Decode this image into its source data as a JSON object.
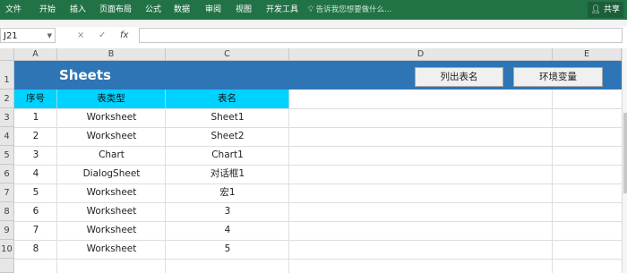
{
  "ribbon": {
    "tabs": [
      "文件",
      "开始",
      "插入",
      "页面布局",
      "公式",
      "数据",
      "审阅",
      "视图",
      "开发工具"
    ],
    "tell_me": "告诉我您想要做什么...",
    "share": "共享"
  },
  "formula_bar": {
    "name_box": "J21",
    "cancel": "×",
    "enter": "✓",
    "fx": "fx",
    "content": ""
  },
  "columns": [
    "A",
    "B",
    "C",
    "D",
    "E"
  ],
  "rows": [
    "1",
    "2",
    "3",
    "4",
    "5",
    "6",
    "7",
    "8",
    "9",
    "10"
  ],
  "sheet": {
    "title": "Sheets",
    "buttons": {
      "list_names": "列出表名",
      "env_vars": "环境变量"
    },
    "headers": [
      "序号",
      "表类型",
      "表名"
    ],
    "data": [
      [
        "1",
        "Worksheet",
        "Sheet1"
      ],
      [
        "2",
        "Worksheet",
        "Sheet2"
      ],
      [
        "3",
        "Chart",
        "Chart1"
      ],
      [
        "4",
        "DialogSheet",
        "对话框1"
      ],
      [
        "5",
        "Worksheet",
        "宏1"
      ],
      [
        "6",
        "Worksheet",
        "3"
      ],
      [
        "7",
        "Worksheet",
        "4"
      ],
      [
        "8",
        "Worksheet",
        "5"
      ]
    ]
  },
  "colors": {
    "ribbon": "#217346",
    "title_bar": "#2e75b6",
    "header_fill": "#00d2ff"
  }
}
